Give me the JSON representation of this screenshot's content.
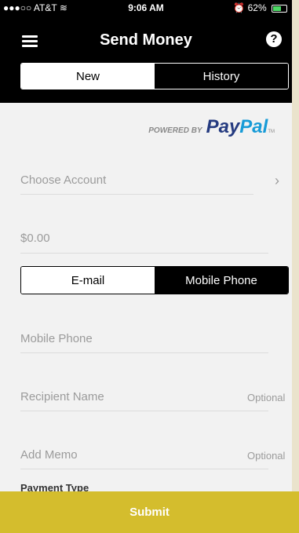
{
  "statusbar": {
    "carrier": "●●●○○ AT&T",
    "wifi_icon": "wifi-icon",
    "time": "9:06 AM",
    "alarm_icon": "alarm-icon",
    "battery": "62%",
    "battery_level": 0.62
  },
  "header": {
    "title": "Send Money",
    "menu_icon": "hamburger-menu-icon",
    "help_icon": "question-mark-icon",
    "help_glyph": "?"
  },
  "tabs": [
    {
      "label": "New",
      "active": true
    },
    {
      "label": "History",
      "active": false
    }
  ],
  "paypal": {
    "powered_by": "POWERED BY",
    "pay": "Pay",
    "pal": "Pal",
    "tm": "TM"
  },
  "form": {
    "account_placeholder": "Choose Account",
    "chevron": "›",
    "amount_placeholder": "$0.00",
    "method_options": [
      {
        "label": "E-mail",
        "selected": false
      },
      {
        "label": "Mobile Phone",
        "selected": true
      }
    ],
    "phone_placeholder": "Mobile Phone",
    "recipient_placeholder": "Recipient Name",
    "recipient_optional": "Optional",
    "memo_placeholder": "Add Memo",
    "memo_optional": "Optional",
    "payment_type_label": "Payment Type"
  },
  "submit_label": "Submit",
  "colors": {
    "accent": "#d4bd2d",
    "paypal_dark": "#253b80",
    "paypal_light": "#179bd7"
  }
}
